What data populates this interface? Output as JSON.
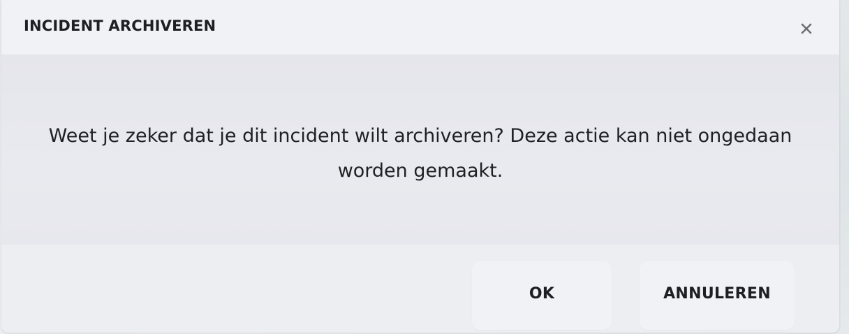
{
  "dialog": {
    "title": "INCIDENT ARCHIVEREN",
    "close_icon": "close-icon",
    "message": "Weet je zeker dat je dit incident wilt archiveren? Deze actie kan niet ongedaan worden gemaakt.",
    "ok_label": "OK",
    "cancel_label": "ANNULEREN"
  },
  "colors": {
    "text": "#1d1f24",
    "dialog_background": "#eceef3",
    "button_background": "#f1f2f5",
    "close_icon": "#6b6e75"
  }
}
